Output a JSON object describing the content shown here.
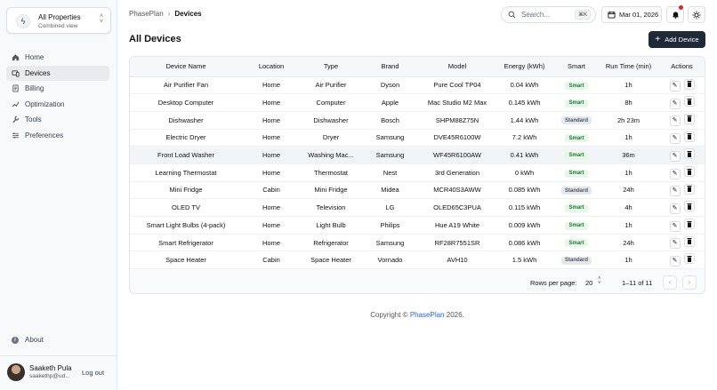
{
  "sidebar": {
    "property": {
      "title": "All Properties",
      "subtitle": "Combined view",
      "icon": "lightning-icon"
    },
    "items": [
      {
        "label": "Home",
        "icon": "home-icon"
      },
      {
        "label": "Devices",
        "icon": "devices-icon",
        "active": true
      },
      {
        "label": "Billing",
        "icon": "billing-icon"
      },
      {
        "label": "Optimization",
        "icon": "optimization-icon"
      },
      {
        "label": "Tools",
        "icon": "wrench-icon"
      },
      {
        "label": "Preferences",
        "icon": "sliders-icon"
      }
    ],
    "about": "About",
    "user": {
      "name": "Saaketh Pula",
      "email": "saakethp@ud...",
      "logout": "Log out"
    }
  },
  "header": {
    "breadcrumb": {
      "root": "PhasePlan",
      "current": "Devices"
    },
    "search": {
      "placeholder": "Search...",
      "shortcut": "⌘K"
    },
    "date": "Mar 01, 2026"
  },
  "main": {
    "title": "All Devices",
    "add_button": "Add Device",
    "columns": [
      "Device Name",
      "Location",
      "Type",
      "Brand",
      "Model",
      "Energy (kWh)",
      "Smart",
      "Run Time (min)",
      "Actions"
    ],
    "rows": [
      [
        "Air Purifier Fan",
        "Home",
        "Air Purifier",
        "Dyson",
        "Pure Cool TP04",
        "0.04 kWh",
        "Smart",
        "1h"
      ],
      [
        "Desktop Computer",
        "Home",
        "Computer",
        "Apple",
        "Mac Studio M2 Max",
        "0.145 kWh",
        "Smart",
        "8h"
      ],
      [
        "Dishwasher",
        "Home",
        "Dishwasher",
        "Bosch",
        "SHPM88Z75N",
        "1.44 kWh",
        "Standard",
        "2h 23m"
      ],
      [
        "Electric Dryer",
        "Home",
        "Dryer",
        "Samsung",
        "DVE45R6100W",
        "7.2 kWh",
        "Smart",
        "1h"
      ],
      [
        "Front Load Washer",
        "Home",
        "Washing Mac...",
        "Samsung",
        "WF45R6100AW",
        "0.41 kWh",
        "Smart",
        "36m"
      ],
      [
        "Learning Thermostat",
        "Home",
        "Thermostat",
        "Nest",
        "3rd Generation",
        "0 kWh",
        "Smart",
        "1h"
      ],
      [
        "Mini Fridge",
        "Cabin",
        "Mini Fridge",
        "Midea",
        "MCR40S3AWW",
        "0.085 kWh",
        "Standard",
        "24h"
      ],
      [
        "OLED TV",
        "Home",
        "Television",
        "LG",
        "OLED65C3PUA",
        "0.115 kWh",
        "Smart",
        "4h"
      ],
      [
        "Smart Light Bulbs (4-pack)",
        "Home",
        "Light Bulb",
        "Philips",
        "Hue A19 White",
        "0.009 kWh",
        "Smart",
        "1h"
      ],
      [
        "Smart Refrigerator",
        "Home",
        "Refrigerator",
        "Samsung",
        "RF28R7551SR",
        "0.086 kWh",
        "Smart",
        "24h"
      ],
      [
        "Space Heater",
        "Cabin",
        "Space Heater",
        "Vornado",
        "AVH10",
        "1.5 kWh",
        "Standard",
        "1h"
      ]
    ],
    "pagination": {
      "rows_per_page_label": "Rows per page:",
      "rows_per_page": "20",
      "range": "1–11 of 11",
      "prev": "‹",
      "next": "›"
    }
  },
  "footer": {
    "prefix": "Copyright ©",
    "brand": "PhasePlan",
    "suffix": "2026."
  },
  "colors": {
    "accent": "#1f2937",
    "smart_badge": "#1f7a36",
    "link": "#2563eb",
    "notification": "#dc2626"
  }
}
